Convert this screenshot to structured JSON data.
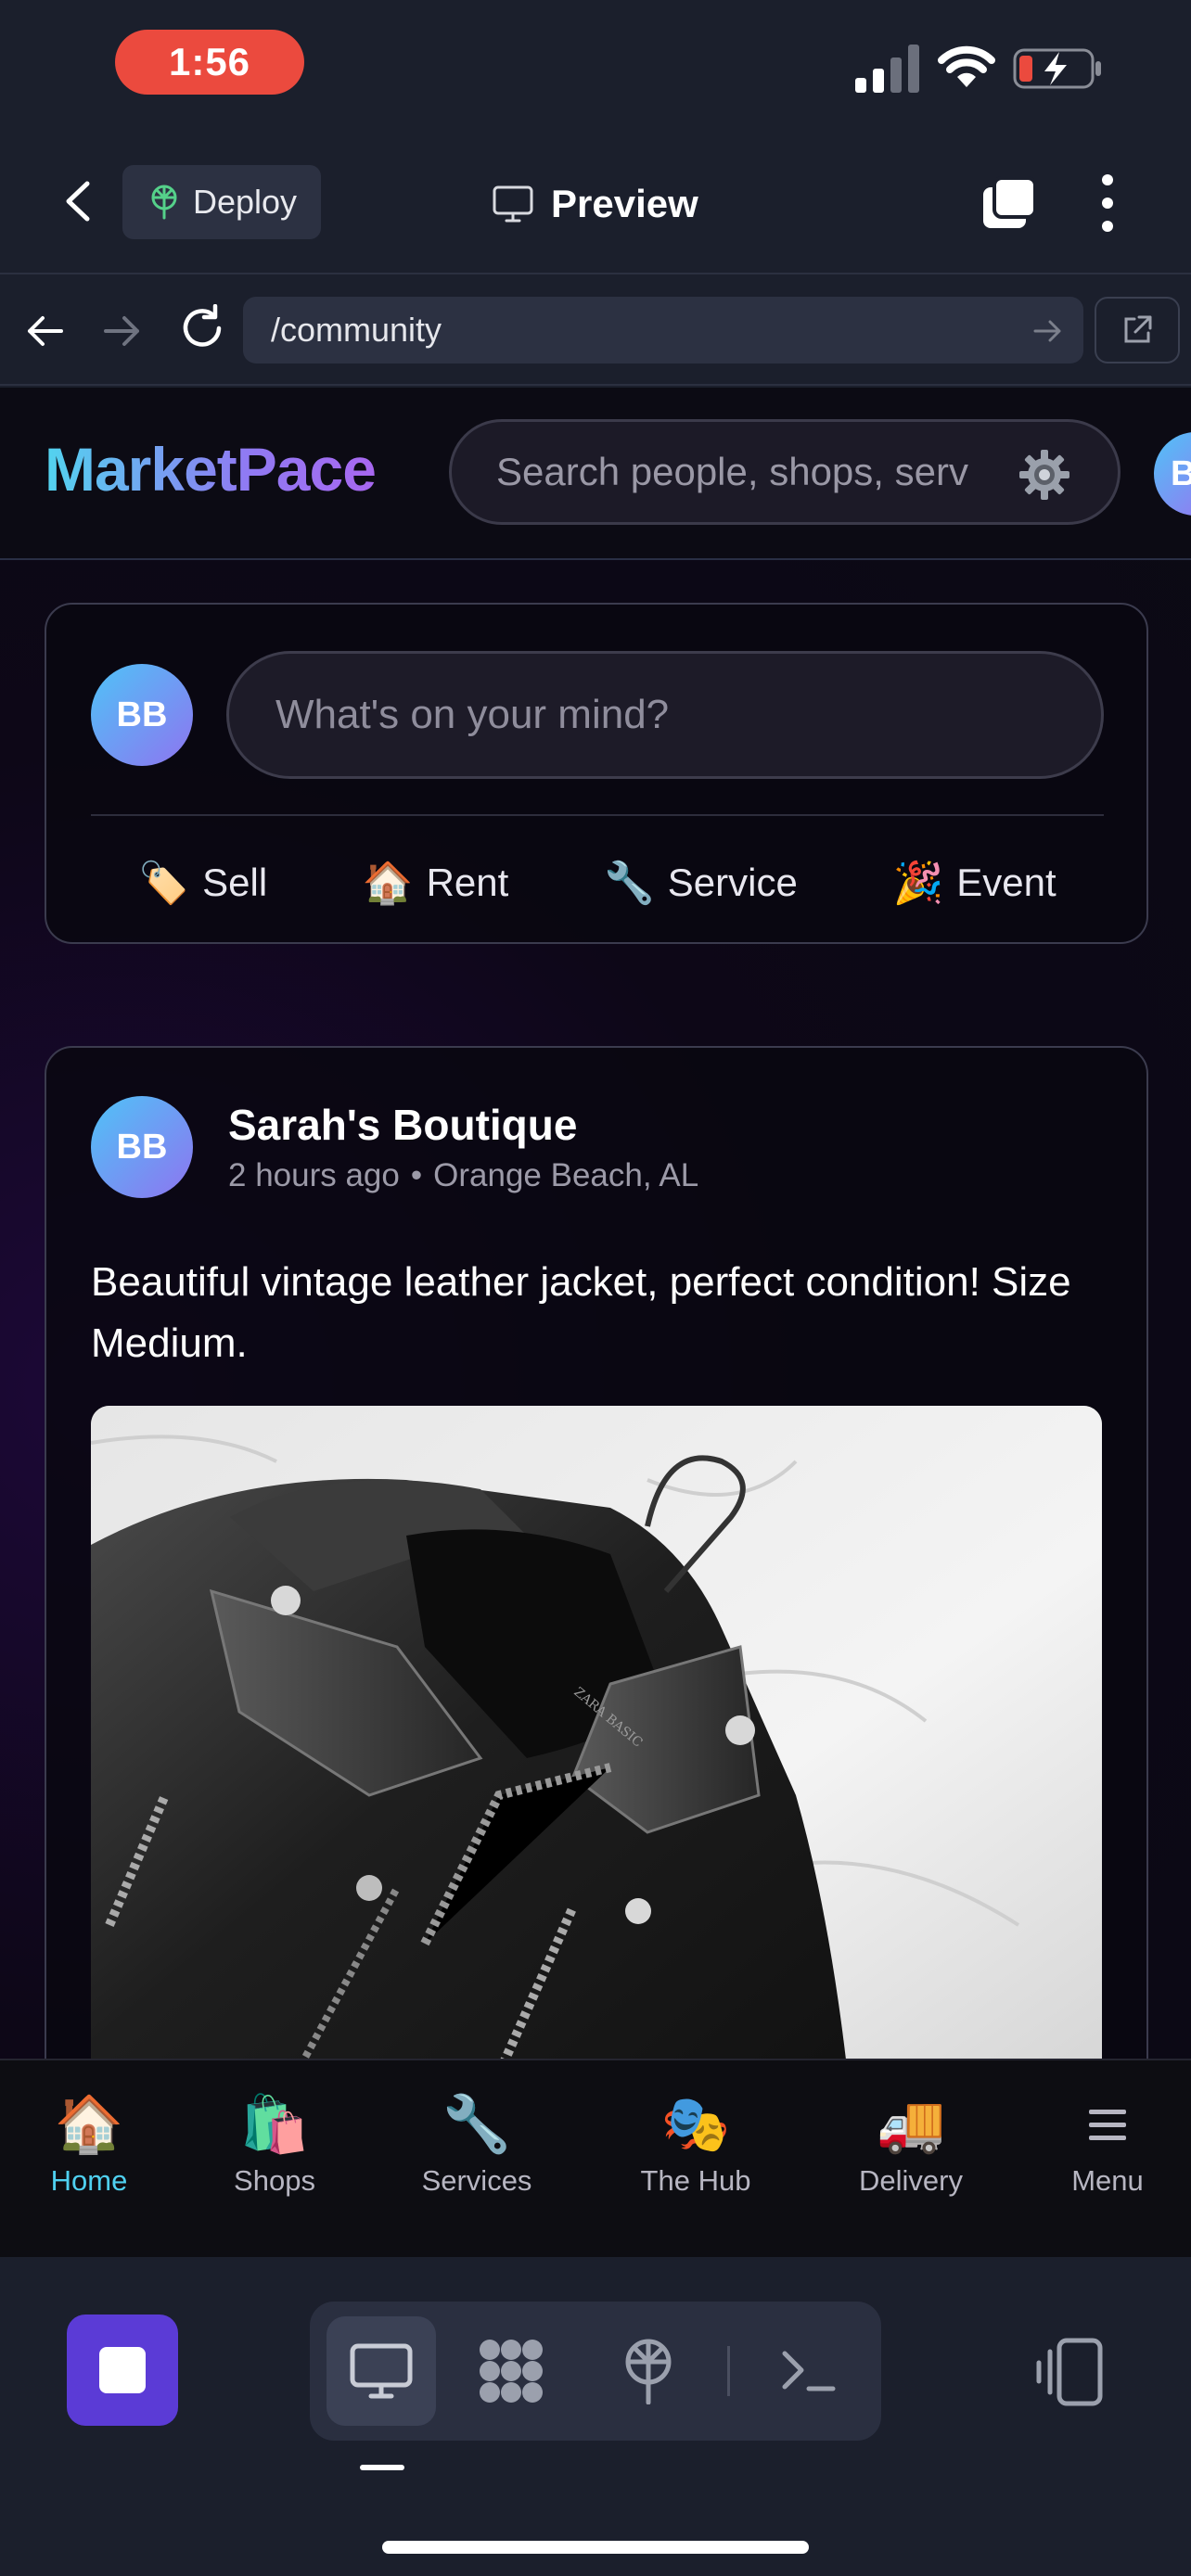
{
  "status_bar": {
    "time": "1:56"
  },
  "app_header": {
    "deploy_label": "Deploy",
    "preview_label": "Preview"
  },
  "browser": {
    "url": "/community"
  },
  "site": {
    "logo": "MarketPace",
    "search_placeholder": "Search people, shops, serv",
    "header_avatar_initials": "B"
  },
  "composer": {
    "avatar_initials": "BB",
    "placeholder": "What's on your mind?",
    "actions": [
      {
        "emoji": "🏷️",
        "label": "Sell"
      },
      {
        "emoji": "🏠",
        "label": "Rent"
      },
      {
        "emoji": "🔧",
        "label": "Service"
      },
      {
        "emoji": "🎉",
        "label": "Event"
      }
    ]
  },
  "post": {
    "avatar_initials": "BB",
    "author": "Sarah's Boutique",
    "time": "2 hours ago",
    "separator": "•",
    "location": "Orange Beach, AL",
    "text": "Beautiful vintage leather jacket, perfect condition! Size Medium.",
    "label_text": "ZARA BASIC"
  },
  "site_nav": {
    "items": [
      {
        "emoji": "🏠",
        "label": "Home",
        "active": true
      },
      {
        "emoji": "🛍️",
        "label": "Shops"
      },
      {
        "emoji": "🔧",
        "label": "Services"
      },
      {
        "emoji": "🎭",
        "label": "The Hub"
      },
      {
        "emoji": "🚚",
        "label": "Delivery"
      },
      {
        "emoji": "",
        "label": "Menu"
      }
    ]
  },
  "colors": {
    "accent": "#4fd0f0",
    "stop_button": "#5b3bd6",
    "recording_pill": "#eb4a3e"
  }
}
